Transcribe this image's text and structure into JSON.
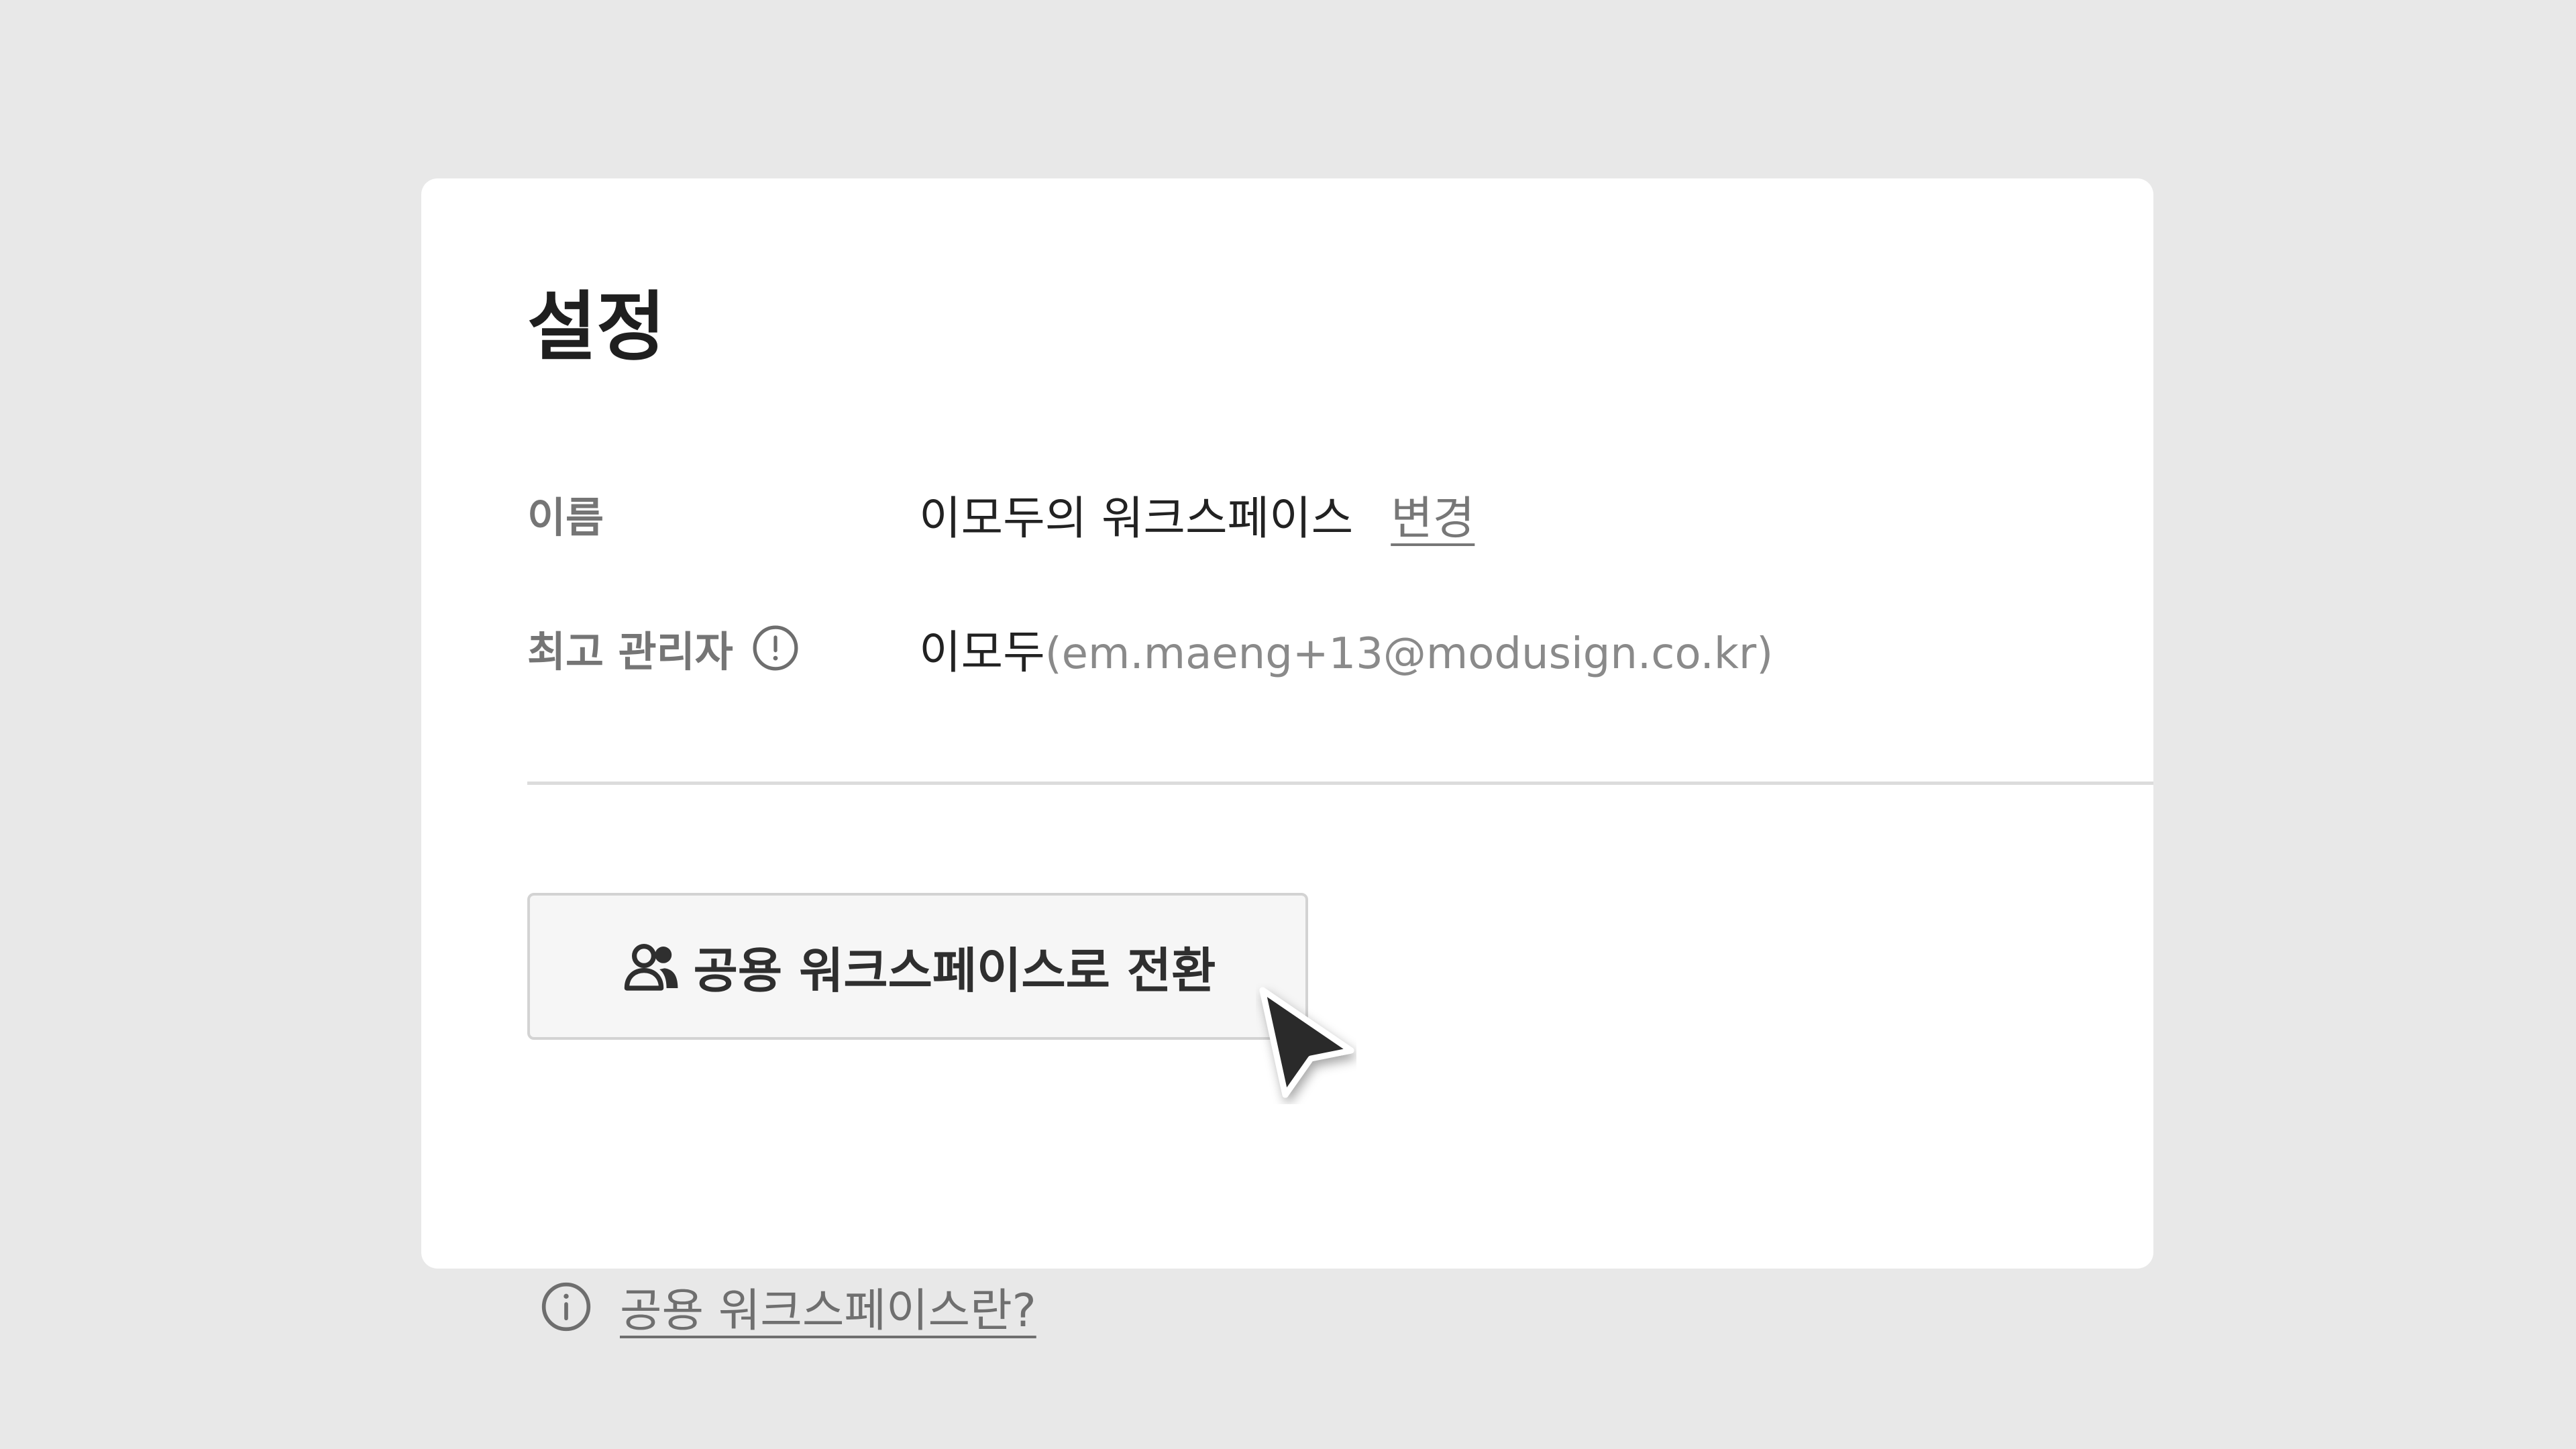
{
  "settings": {
    "title": "설정",
    "name_row": {
      "label": "이름",
      "value": "이모두의 워크스페이스",
      "change_link": "변경"
    },
    "admin_row": {
      "label": "최고 관리자",
      "label_icon": "info-circle-icon",
      "name": "이모두",
      "email": "(em.maeng+13@modusign.co.kr)"
    },
    "convert_button": {
      "icon": "users-icon",
      "label": "공용 워크스페이스로 전환"
    },
    "help": {
      "icon": "info-circle-icon",
      "link": "공용 워크스페이스란?"
    }
  },
  "cursor": {
    "icon": "mouse-pointer-icon"
  },
  "colors": {
    "background": "#e8e8e8",
    "card": "#ffffff",
    "title": "#1f1f1f",
    "label": "#757575",
    "muted": "#8a8a8a",
    "button_bg": "#f6f6f6",
    "button_border": "#d3d3d3"
  }
}
